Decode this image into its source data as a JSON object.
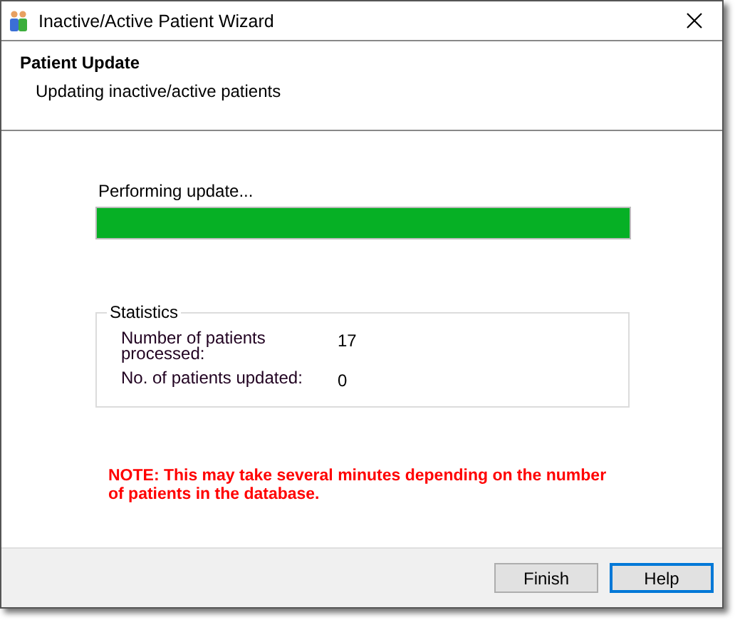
{
  "window": {
    "title": "Inactive/Active Patient Wizard"
  },
  "header": {
    "title": "Patient Update",
    "subtitle": "Updating inactive/active patients"
  },
  "progress": {
    "label": "Performing update...",
    "level": 1
  },
  "statistics": {
    "title": "Statistics",
    "rows": [
      {
        "label": "Number of patients processed:",
        "value": "17"
      },
      {
        "label": "No. of patients updated:",
        "value": "0"
      }
    ]
  },
  "note": "NOTE: This may take several minutes depending on the number of patients in the database.",
  "buttons": [
    {
      "label": "Finish",
      "focused": false
    },
    {
      "label": "Help",
      "focused": true
    }
  ]
}
